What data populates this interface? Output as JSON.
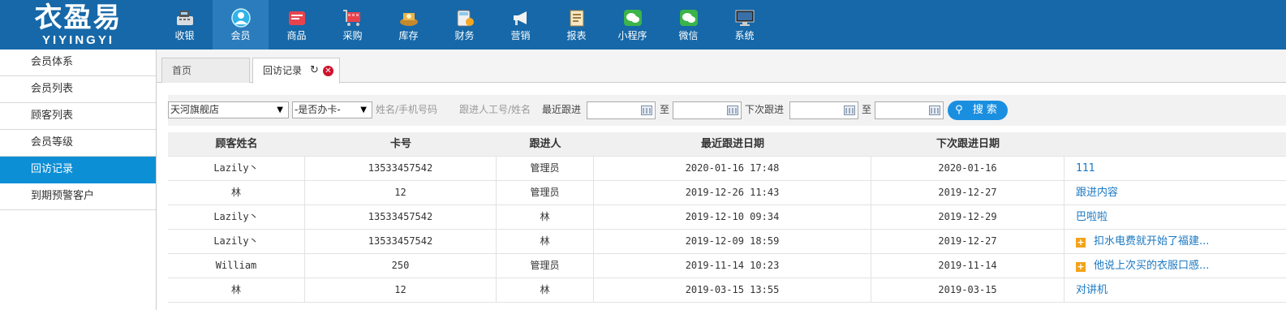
{
  "logo": {
    "cn": "衣盈易",
    "en": "YIYINGYI"
  },
  "nav": [
    {
      "label": "收银",
      "icon": "cash-register-icon",
      "active": false
    },
    {
      "label": "会员",
      "icon": "member-icon",
      "active": true
    },
    {
      "label": "商品",
      "icon": "goods-icon",
      "active": false
    },
    {
      "label": "采购",
      "icon": "cart-icon",
      "active": false
    },
    {
      "label": "库存",
      "icon": "inventory-icon",
      "active": false
    },
    {
      "label": "财务",
      "icon": "finance-icon",
      "active": false
    },
    {
      "label": "营销",
      "icon": "megaphone-icon",
      "active": false
    },
    {
      "label": "报表",
      "icon": "report-icon",
      "active": false
    },
    {
      "label": "小程序",
      "icon": "wechat-icon",
      "active": false
    },
    {
      "label": "微信",
      "icon": "wechat-icon",
      "active": false
    },
    {
      "label": "系统",
      "icon": "monitor-icon",
      "active": false
    }
  ],
  "sidebar": {
    "items": [
      {
        "label": "会员体系"
      },
      {
        "label": "会员列表"
      },
      {
        "label": "顾客列表"
      },
      {
        "label": "会员等级"
      },
      {
        "label": "回访记录",
        "active": true
      },
      {
        "label": "到期预警客户"
      }
    ]
  },
  "tabs": {
    "home": "首页",
    "current": "回访记录"
  },
  "filter": {
    "store": "天河旗舰店",
    "card_status": "-是否办卡-",
    "name_placeholder": "姓名/手机号码",
    "follower_placeholder": "跟进人工号/姓名",
    "recent_label": "最近跟进",
    "to1": "至",
    "next_label": "下次跟进",
    "to2": "至",
    "search": "搜索"
  },
  "table": {
    "headers": [
      "顾客姓名",
      "卡号",
      "跟进人",
      "最近跟进日期",
      "下次跟进日期",
      ""
    ],
    "rows": [
      {
        "name": "Lazily丶",
        "card": "13533457542",
        "follower": "管理员",
        "recent": "2020-01-16 17:48",
        "next": "2020-01-16",
        "content": "111",
        "expand": false
      },
      {
        "name": "林",
        "card": "12",
        "follower": "管理员",
        "recent": "2019-12-26 11:43",
        "next": "2019-12-27",
        "content": "跟进内容",
        "expand": false
      },
      {
        "name": "Lazily丶",
        "card": "13533457542",
        "follower": "林",
        "recent": "2019-12-10 09:34",
        "next": "2019-12-29",
        "content": "巴啦啦",
        "expand": false
      },
      {
        "name": "Lazily丶",
        "card": "13533457542",
        "follower": "林",
        "recent": "2019-12-09 18:59",
        "next": "2019-12-27",
        "content": "扣水电费就开始了福建...",
        "expand": true
      },
      {
        "name": "William",
        "card": "250",
        "follower": "管理员",
        "recent": "2019-11-14 10:23",
        "next": "2019-11-14",
        "content": "他说上次买的衣服口感...",
        "expand": true
      },
      {
        "name": "林",
        "card": "12",
        "follower": "林",
        "recent": "2019-03-15 13:55",
        "next": "2019-03-15",
        "content": "对讲机",
        "expand": false
      }
    ]
  },
  "colors": {
    "topbar": "#1668a8",
    "accent": "#0d8fd6",
    "link": "#1a78c2",
    "close": "#d0112b"
  }
}
